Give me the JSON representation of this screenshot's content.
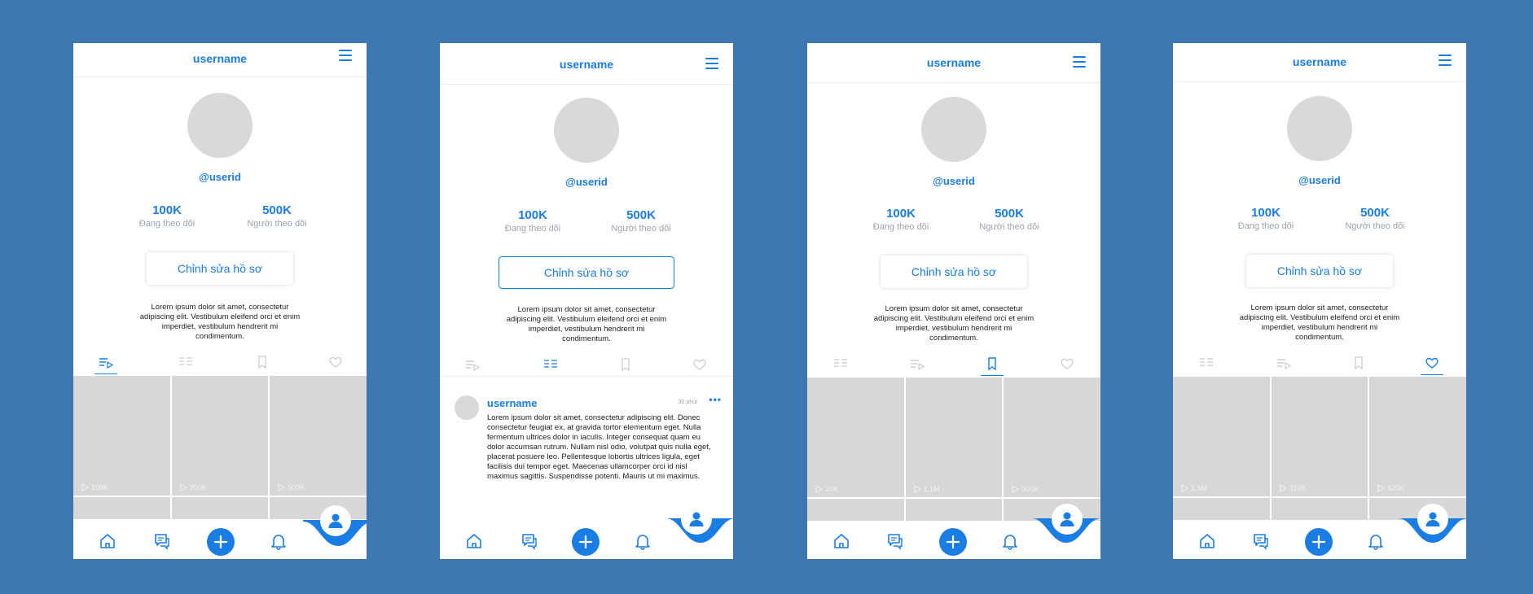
{
  "screens": [
    {
      "header_title": "username",
      "userid": "@userid",
      "stats": [
        {
          "value": "100K",
          "label": "Đang theo dõi"
        },
        {
          "value": "500K",
          "label": "Người theo dõi"
        }
      ],
      "edit_button": "Chỉnh sửa hồ sơ",
      "bio": "Lorem ipsum dolor sit amet, consectetur adipiscing elit. Vestibulum eleifend orci et enim imperdiet, vestibulum hendrerit mi condimentum.",
      "active_tab": "videos",
      "videos": [
        "100K",
        "200K",
        "500K"
      ]
    },
    {
      "header_title": "username",
      "userid": "@userid",
      "stats": [
        {
          "value": "100K",
          "label": "Đang theo dõi"
        },
        {
          "value": "500K",
          "label": "Người theo dõi"
        }
      ],
      "edit_button": "Chỉnh sửa hồ sơ",
      "bio": "Lorem ipsum dolor sit amet, consectetur adipiscing elit. Vestibulum eleifend orci et enim imperdiet, vestibulum hendrerit mi condimentum.",
      "active_tab": "posts",
      "post": {
        "username": "username",
        "time": "30 phút",
        "text": "Lorem ipsum dolor sit amet, consectetur adipiscing elit. Donec consectetur feugiat ex, at gravida tortor elementum eget. Nulla fermentum ultrices dolor in iaculis. Integer consequat quam eu dolor accumsan rutrum. Nullam nisl odio, volutpat quis nulla eget, placerat posuere leo. Pellentesque lobortis ultrices ligula, eget facilisis dui tempor eget. Maecenas ullamcorper orci id nisl maximus sagittis. Suspendisse potenti. Mauris ut mi maximus."
      }
    },
    {
      "header_title": "username",
      "userid": "@userid",
      "stats": [
        {
          "value": "100K",
          "label": "Đang theo dõi"
        },
        {
          "value": "500K",
          "label": "Người theo dõi"
        }
      ],
      "edit_button": "Chỉnh sửa hồ sơ",
      "bio": "Lorem ipsum dolor sit amet, consectetur adipiscing elit. Vestibulum eleifend orci et enim imperdiet, vestibulum hendrerit mi condimentum.",
      "active_tab": "saved",
      "videos": [
        "20K",
        "1,1M",
        "900K"
      ]
    },
    {
      "header_title": "username",
      "userid": "@userid",
      "stats": [
        {
          "value": "100K",
          "label": "Đang theo dõi"
        },
        {
          "value": "500K",
          "label": "Người theo dõi"
        }
      ],
      "edit_button": "Chỉnh sửa hồ sơ",
      "bio": "Lorem ipsum dolor sit amet, consectetur adipiscing elit. Vestibulum eleifend orci et enim imperdiet, vestibulum hendrerit mi condimentum.",
      "active_tab": "liked",
      "videos": [
        "1,5M",
        "310K",
        "620K"
      ]
    }
  ],
  "colors": {
    "background": "#3d77b2",
    "accent": "#1a7de4",
    "placeholder": "#d7d7d7",
    "muted_text": "#9aa3ad"
  },
  "icons": {
    "header": "menu-icon",
    "tabs": [
      "video-list-icon",
      "posts-list-icon",
      "bookmark-icon",
      "heart-icon"
    ],
    "bottom_nav": [
      "home-icon",
      "chat-icon",
      "add-icon",
      "bell-icon",
      "profile-icon"
    ]
  }
}
